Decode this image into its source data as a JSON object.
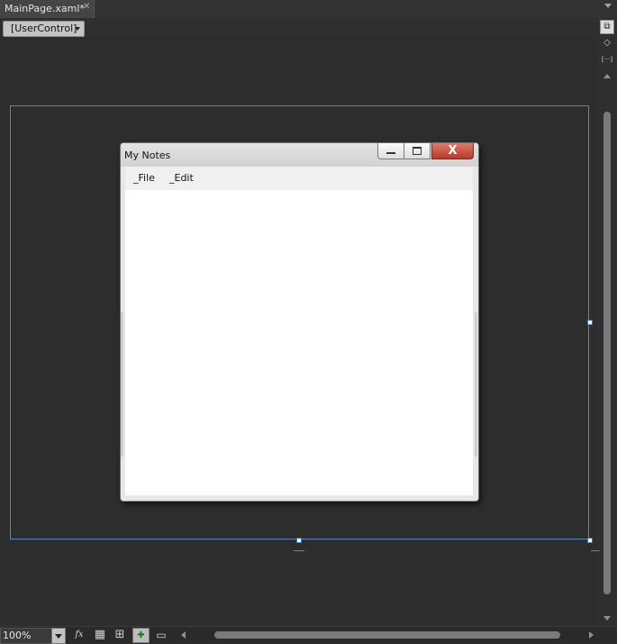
{
  "document_tab": {
    "title": "MainPage.xaml*",
    "close_glyph": "✕"
  },
  "breadcrumb": {
    "label": "[UserControl]"
  },
  "rail": {
    "buttons": [
      {
        "icon": "design-view-icon",
        "glyph": "⧉"
      },
      {
        "icon": "xaml-view-icon",
        "glyph": "◇"
      },
      {
        "icon": "split-view-icon",
        "glyph": "[···]"
      }
    ]
  },
  "window": {
    "title": "My Notes",
    "close_glyph": "X",
    "menu": [
      {
        "label": "_File"
      },
      {
        "label": "_Edit"
      }
    ]
  },
  "statusbar": {
    "zoom": "100%",
    "buttons": [
      {
        "icon": "effects-icon",
        "glyph": "fx"
      },
      {
        "icon": "grid-icon",
        "glyph": "▦"
      },
      {
        "icon": "snap-gridlines-icon",
        "glyph": "⊞"
      },
      {
        "icon": "snap-snaplines-icon",
        "glyph": "✚"
      },
      {
        "icon": "annotation-icon",
        "glyph": "▭"
      }
    ]
  },
  "colors": {
    "accent": "#5b84c4",
    "close_button": "#c0392b",
    "canvas": "#2d2d2d"
  }
}
